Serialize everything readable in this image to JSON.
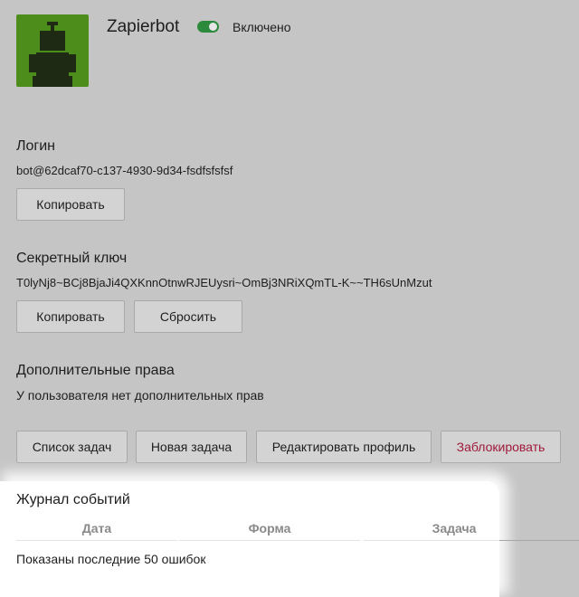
{
  "profile": {
    "name": "Zapierbot",
    "enabled": true,
    "status_label": "Включено",
    "avatar_icon": "robot-icon"
  },
  "login": {
    "title": "Логин",
    "value": "bot@62dcaf70-c137-4930-9d34-fsdfsfsfsf",
    "copy_label": "Копировать"
  },
  "secret": {
    "title": "Секретный ключ",
    "value": "T0lyNj8~BCj8BjaJi4QXKnnOtnwRJEUysri~OmBj3NRiXQmTL-K~~TH6sUnMzut",
    "copy_label": "Копировать",
    "reset_label": "Сбросить"
  },
  "permissions": {
    "title": "Дополнительные права",
    "text": "У пользователя нет дополнительных прав"
  },
  "actions": {
    "task_list": "Список задач",
    "new_task": "Новая задача",
    "edit_profile": "Редактировать профиль",
    "block": "Заблокировать"
  },
  "event_log": {
    "title": "Журнал событий",
    "columns": [
      "Дата",
      "Форма",
      "Задача"
    ],
    "note": "Показаны последние 50 ошибок"
  },
  "colors": {
    "overlay": "#c5c5c5",
    "avatar_bg": "#4d8d1c",
    "toggle_on": "#2c8a3c",
    "danger": "#a01a3a"
  }
}
